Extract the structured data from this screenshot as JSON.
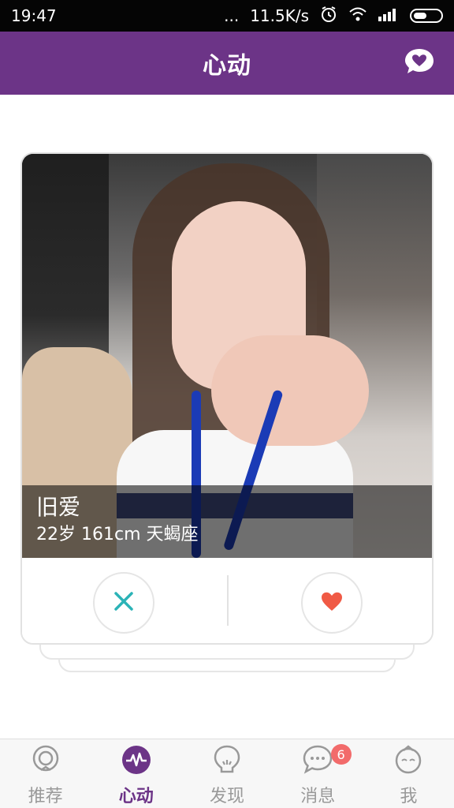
{
  "status_bar": {
    "time": "19:47",
    "dots": "...",
    "speed": "11.5K/s",
    "icons": [
      "alarm-icon",
      "wifi-icon",
      "signal-icon",
      "battery-icon"
    ]
  },
  "app_bar": {
    "title": "心动",
    "right_icon": "heart-chat-icon",
    "color": "#6c3487"
  },
  "card": {
    "name": "旧爱",
    "info": "22岁  161cm 天蝎座",
    "dislike_icon": "close-icon",
    "like_icon": "heart-icon",
    "dislike_color": "#2bb3b7",
    "like_color": "#f05a45"
  },
  "tabs": [
    {
      "label": "推荐",
      "icon": "recommend-icon",
      "active": false
    },
    {
      "label": "心动",
      "icon": "heartbeat-icon",
      "active": true
    },
    {
      "label": "发现",
      "icon": "discover-icon",
      "active": false
    },
    {
      "label": "消息",
      "icon": "message-icon",
      "active": false,
      "badge": "6"
    },
    {
      "label": "我",
      "icon": "profile-icon",
      "active": false
    }
  ]
}
